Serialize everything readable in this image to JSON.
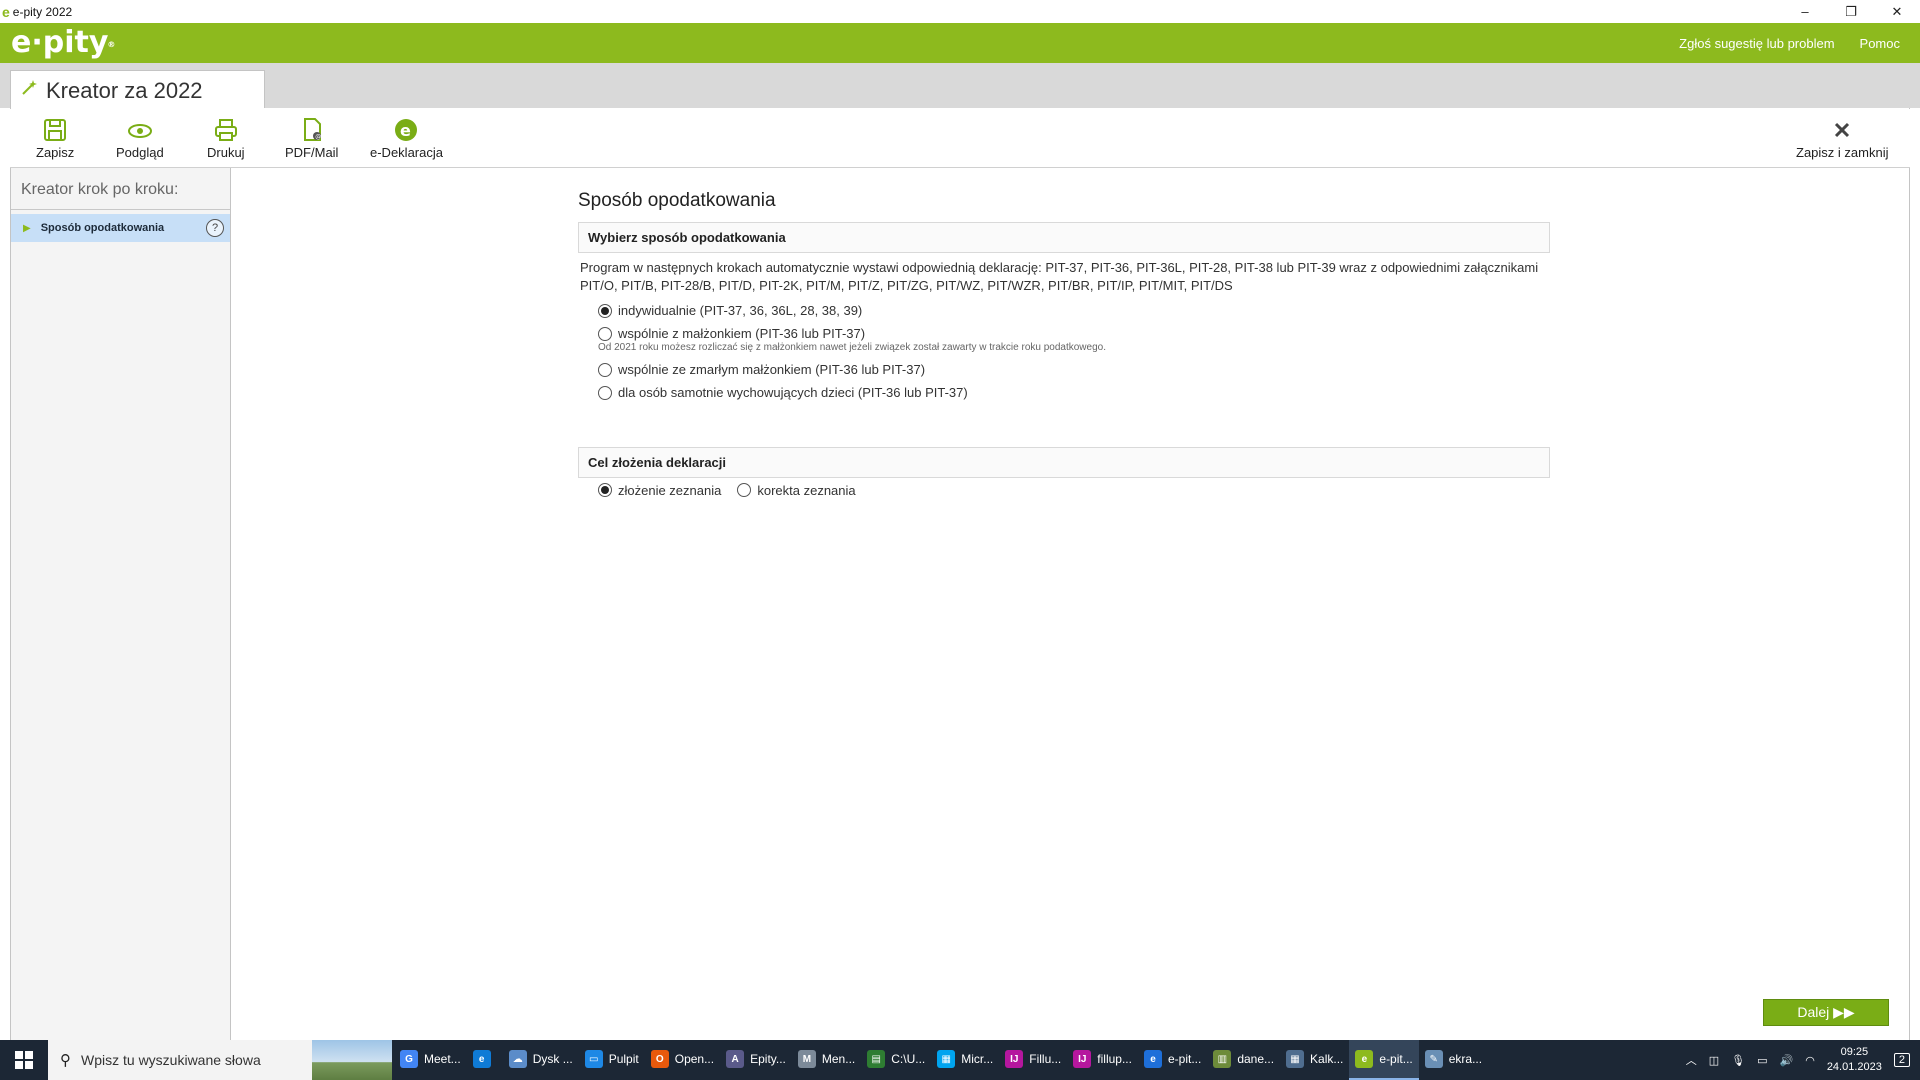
{
  "window": {
    "title": "e-pity 2022",
    "minimize": "–",
    "restore": "❐",
    "close": "✕"
  },
  "brand": {
    "logo": "e·pity",
    "logo_mark": "®",
    "links": [
      "Zgłoś sugestię lub problem",
      "Pomoc"
    ]
  },
  "tab": {
    "title": "Kreator za 2022"
  },
  "toolbar": {
    "save": "Zapisz",
    "preview": "Podgląd",
    "print": "Drukuj",
    "pdf_mail": "PDF/Mail",
    "edeclaration": "e-Deklaracja",
    "save_close": "Zapisz i zamknij"
  },
  "sidebar": {
    "heading": "Kreator krok po kroku:",
    "items": [
      {
        "label": "Sposób opodatkowania",
        "help": "?"
      }
    ]
  },
  "main": {
    "title": "Sposób opodatkowania",
    "section1": {
      "heading": "Wybierz sposób opodatkowania",
      "description": "Program w następnych krokach automatycznie wystawi odpowiednią deklarację: PIT-37, PIT-36, PIT-36L, PIT-28, PIT-38 lub PIT-39 wraz z odpowiednimi załącznikami PIT/O, PIT/B, PIT-28/B, PIT/D, PIT-2K, PIT/M, PIT/Z, PIT/ZG, PIT/WZ, PIT/WZR, PIT/BR, PIT/IP, PIT/MIT, PIT/DS",
      "options": [
        {
          "label": "indywidualnie (PIT-37, 36, 36L, 28, 38, 39)",
          "selected": true
        },
        {
          "label": "wspólnie z małżonkiem (PIT-36 lub PIT-37)",
          "selected": false
        },
        {
          "label": "wspólnie ze zmarłym małżonkiem (PIT-36 lub PIT-37)",
          "selected": false
        },
        {
          "label": "dla osób samotnie wychowujących dzieci (PIT-36 lub PIT-37)",
          "selected": false
        }
      ],
      "note": "Od 2021 roku możesz rozliczać się z małżonkiem nawet jeżeli związek został zawarty w trakcie roku podatkowego."
    },
    "section2": {
      "heading": "Cel złożenia deklaracji",
      "options": [
        {
          "label": "złożenie zeznania",
          "selected": true
        },
        {
          "label": "korekta zeznania",
          "selected": false
        }
      ]
    },
    "next_button": "Dalej ▶▶"
  },
  "taskbar": {
    "search_placeholder": "Wpisz tu wyszukiwane słowa",
    "items": [
      {
        "label": "Meet...",
        "color": "#4285f4",
        "glyph": "G"
      },
      {
        "label": "",
        "color": "#0f7bd6",
        "glyph": "e"
      },
      {
        "label": "Dysk ...",
        "color": "#5b8cc9",
        "glyph": "☁"
      },
      {
        "label": "Pulpit",
        "color": "#1e88e5",
        "glyph": "▭"
      },
      {
        "label": "Open...",
        "color": "#e8590c",
        "glyph": "O"
      },
      {
        "label": "Epity...",
        "color": "#5a5a8a",
        "glyph": "A"
      },
      {
        "label": "Men...",
        "color": "#7c8a99",
        "glyph": "M"
      },
      {
        "label": "C:\\U...",
        "color": "#2e7d32",
        "glyph": "▤"
      },
      {
        "label": "Micr...",
        "color": "#00a4ef",
        "glyph": "▦"
      },
      {
        "label": "Fillu...",
        "color": "#b5179e",
        "glyph": "IJ"
      },
      {
        "label": "fillup...",
        "color": "#b5179e",
        "glyph": "IJ"
      },
      {
        "label": "e-pit...",
        "color": "#1e6fd9",
        "glyph": "e"
      },
      {
        "label": "dane...",
        "color": "#6d8b3a",
        "glyph": "▥"
      },
      {
        "label": "Kalk...",
        "color": "#4f6d8f",
        "glyph": "▦"
      },
      {
        "label": "e-pit...",
        "color": "#8dba1e",
        "glyph": "e",
        "active": true
      },
      {
        "label": "ekra...",
        "color": "#6a8fb5",
        "glyph": "✎"
      }
    ],
    "time": "09:25",
    "date": "24.01.2023",
    "notifications": "2"
  },
  "colors": {
    "brand_green": "#8dba1e",
    "selection_blue": "#c7dff7",
    "next_button": "#7aad16",
    "taskbar": "#1c2735"
  }
}
